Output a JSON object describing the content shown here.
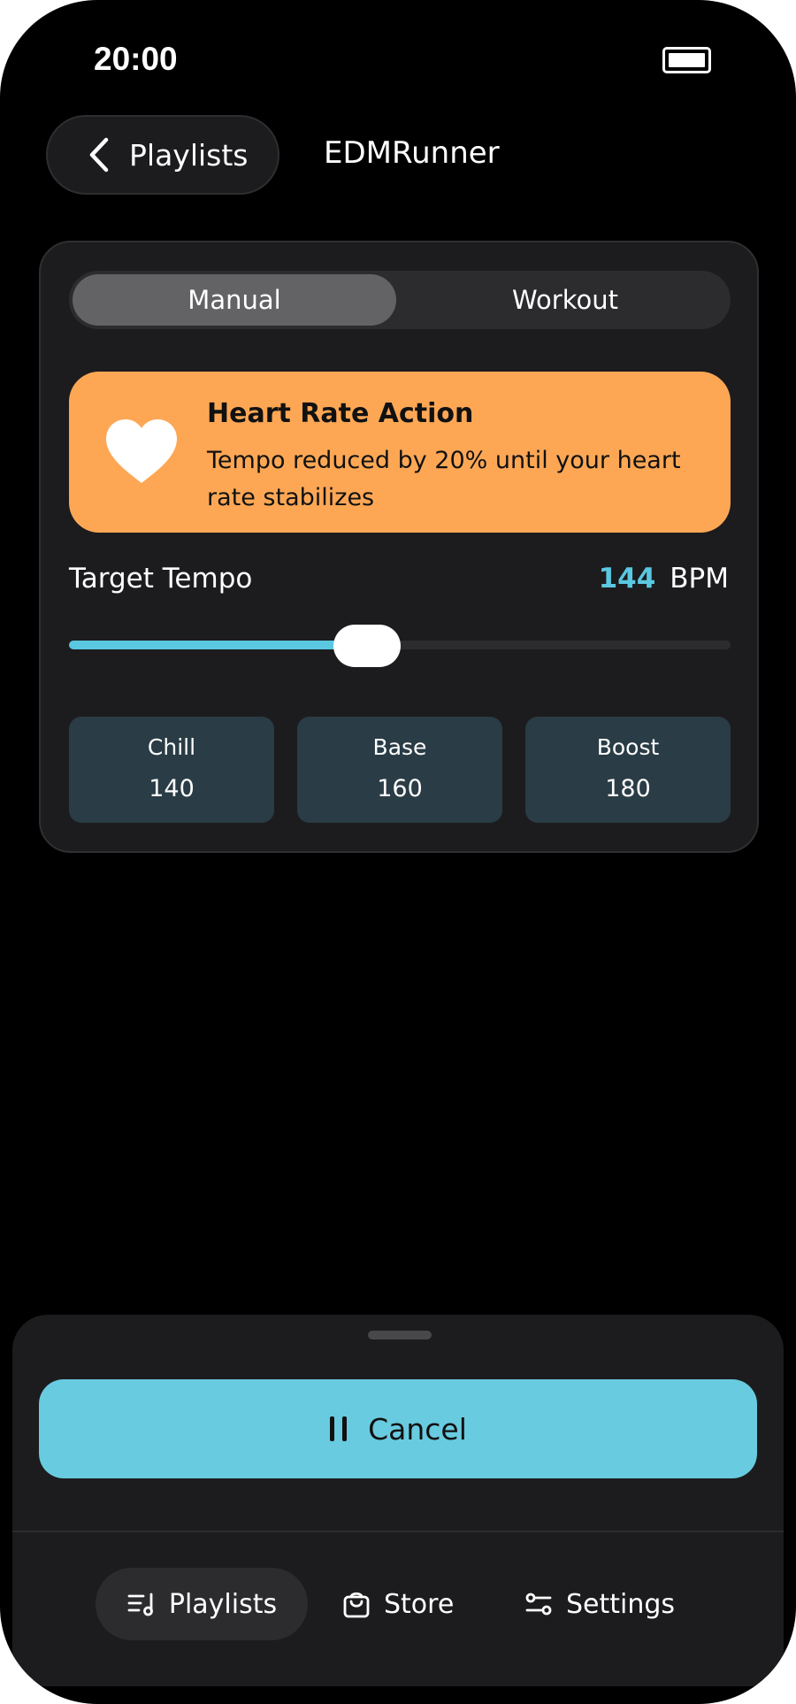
{
  "status_bar": {
    "time": "20:00"
  },
  "header": {
    "back_label": "Playlists",
    "title": "EDMRunner"
  },
  "mode_toggle": {
    "options": [
      "Manual",
      "Workout"
    ],
    "selected": "Manual"
  },
  "alert": {
    "title": "Heart Rate Action",
    "body": "Tempo reduced by 20% until your heart rate stabilizes",
    "color": "#fda755"
  },
  "tempo": {
    "label": "Target Tempo",
    "value": "144",
    "unit": "BPM",
    "slider_fraction": 0.45
  },
  "presets": [
    {
      "name": "Chill",
      "value": "140"
    },
    {
      "name": "Base",
      "value": "160"
    },
    {
      "name": "Boost",
      "value": "180"
    }
  ],
  "action": {
    "cancel_label": "Cancel",
    "color": "#69cbe0"
  },
  "tabs": [
    {
      "label": "Playlists",
      "icon": "playlist-icon",
      "active": true
    },
    {
      "label": "Store",
      "icon": "bag-icon",
      "active": false
    },
    {
      "label": "Settings",
      "icon": "sliders-icon",
      "active": false
    }
  ],
  "colors": {
    "accent": "#5ac8e0"
  }
}
